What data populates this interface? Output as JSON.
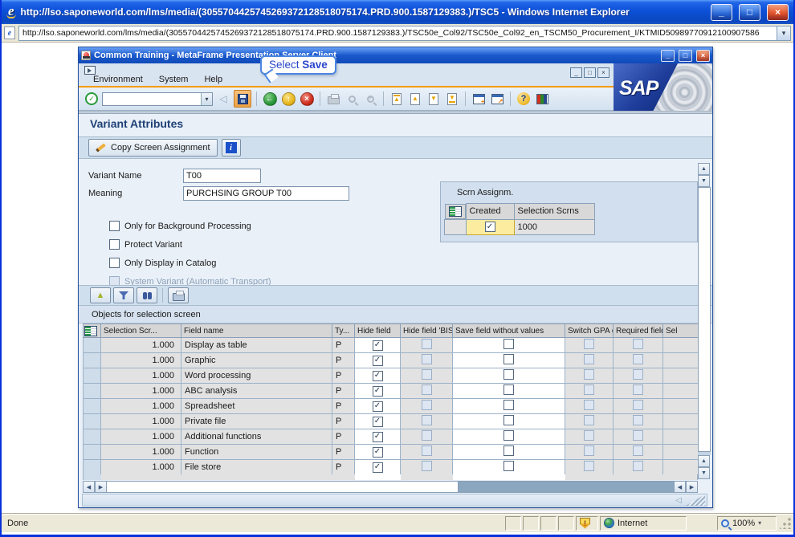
{
  "browser": {
    "title": "http://lso.saponeworld.com/lms/media/(3055704425745269372128518075174.PRD.900.1587129383.)/TSC5 - Windows Internet Explorer",
    "url": "http://lso.saponeworld.com/lms/media/(3055704425745269372128518075174.PRD.900.1587129383.)/TSC50e_Col92/TSC50e_Col92_en_TSCM50_Procurement_I/KTMID50989770912100907586",
    "status": {
      "text": "Done",
      "zone": "Internet",
      "zoom": "100%"
    }
  },
  "window": {
    "title": "Common Training - MetaFrame Presentation Server Client"
  },
  "menubar": {
    "items": [
      {
        "label": "Environment"
      },
      {
        "label": "System"
      },
      {
        "label": "Help"
      }
    ]
  },
  "callout": {
    "prefix": "Select ",
    "action": "Save"
  },
  "sap_logo": "SAP",
  "screen": {
    "title": "Variant Attributes"
  },
  "app_toolbar": {
    "copy_button": "Copy Screen Assignment"
  },
  "form": {
    "variant_name_label": "Variant Name",
    "variant_name_value": "T00",
    "meaning_label": "Meaning",
    "meaning_value": "PURCHSING GROUP T00",
    "checkboxes": [
      {
        "label": "Only for Background Processing",
        "checked": false,
        "enabled": true
      },
      {
        "label": "Protect Variant",
        "checked": false,
        "enabled": true
      },
      {
        "label": "Only Display in Catalog",
        "checked": false,
        "enabled": true
      },
      {
        "label": "System Variant (Automatic Transport)",
        "checked": false,
        "enabled": false
      }
    ]
  },
  "scrn_assignm": {
    "title": "Scrn Assignm.",
    "columns": [
      "Created",
      "Selection Scrns"
    ],
    "rows": [
      {
        "created_checked": true,
        "selection_scrns": "1000"
      }
    ]
  },
  "objects_table": {
    "section_title": "Objects for selection screen",
    "columns": [
      "Selection Scr...",
      "Field name",
      "Ty...",
      "Hide field",
      "Hide field 'BIS'",
      "Save field without values",
      "Switch GPA off",
      "Required field",
      "Sel"
    ],
    "checkbox_states": {
      "hide_field": "checked",
      "hide_field_bis": "disabled",
      "save_field_without_values": "unchecked",
      "switch_gpa_off": "disabled",
      "required_field": "disabled"
    },
    "rows": [
      {
        "selection_scr": "1.000",
        "field_name": "Display as table",
        "ty": "P"
      },
      {
        "selection_scr": "1.000",
        "field_name": "Graphic",
        "ty": "P"
      },
      {
        "selection_scr": "1.000",
        "field_name": "Word processing",
        "ty": "P"
      },
      {
        "selection_scr": "1.000",
        "field_name": "ABC analysis",
        "ty": "P"
      },
      {
        "selection_scr": "1.000",
        "field_name": "Spreadsheet",
        "ty": "P"
      },
      {
        "selection_scr": "1.000",
        "field_name": "Private file",
        "ty": "P"
      },
      {
        "selection_scr": "1.000",
        "field_name": "Additional functions",
        "ty": "P"
      },
      {
        "selection_scr": "1.000",
        "field_name": "Function",
        "ty": "P"
      },
      {
        "selection_scr": "1.000",
        "field_name": "File store",
        "ty": "P"
      }
    ]
  },
  "glyphs": {
    "check": "✓",
    "x": "×",
    "up": "▲",
    "down": "▼",
    "left": "◀",
    "right": "▶",
    "tri_left": "◁",
    "dropdown": "▾",
    "back": "←",
    "exit_up": "↑",
    "question": "?",
    "info": "i",
    "minimize": "_",
    "maximize": "□",
    "plus": "+",
    "shortcut": "↗",
    "e": "e"
  },
  "colors": {
    "accent_orange": "#f59b00",
    "sap_blue": "#1e3d9a",
    "highlight_save": "#eda246",
    "row_grey": "#e2e2e2",
    "yellow_cell": "#fbeca0"
  }
}
